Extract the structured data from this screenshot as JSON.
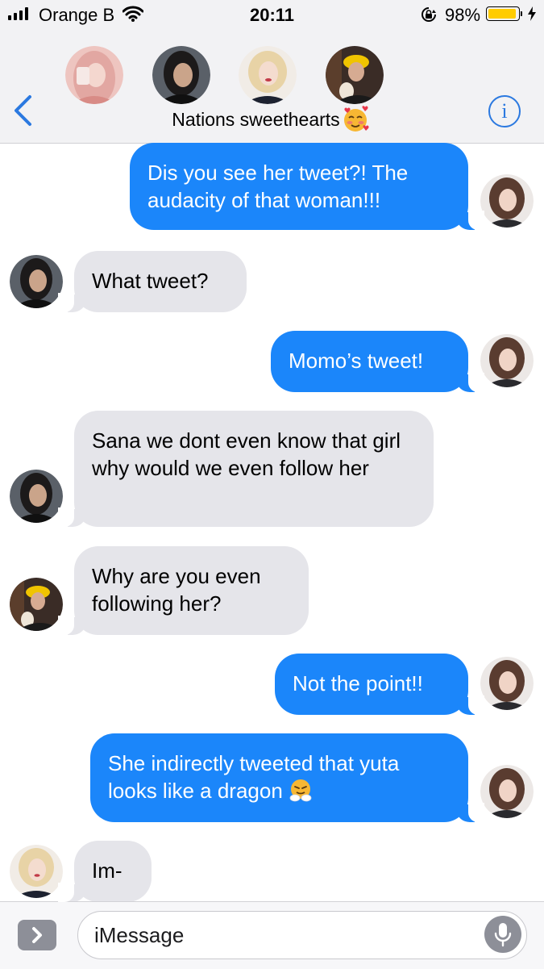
{
  "status_bar": {
    "carrier": "Orange B",
    "time": "20:11",
    "battery_percent": "98%",
    "battery_level": 0.98
  },
  "header": {
    "group_name": "Nations sweethearts",
    "group_emoji": "smiling-face-with-hearts",
    "participants": [
      "avatar-1",
      "avatar-2",
      "avatar-3",
      "avatar-4"
    ],
    "info_label": "i"
  },
  "messages": [
    {
      "side": "out",
      "text": "Dis you see her tweet?! The audacity of that woman!!!"
    },
    {
      "side": "in",
      "text": "What tweet?"
    },
    {
      "side": "out",
      "text": "Momo’s tweet!"
    },
    {
      "side": "in",
      "text": "Sana we dont even know that girl why would we even follow her"
    },
    {
      "side": "in",
      "text": "Why are you even following her?"
    },
    {
      "side": "out",
      "text": "Not the point!!"
    },
    {
      "side": "out",
      "text": "She indirectly tweeted that yuta looks like a dragon",
      "emoji": "face-with-steam-from-nose"
    },
    {
      "side": "in",
      "text": "Im-"
    }
  ],
  "input": {
    "placeholder": "iMessage"
  },
  "colors": {
    "accent": "#2b79e0",
    "outgoing_bubble": "#1b86fa",
    "incoming_bubble": "#e5e5ea",
    "battery": "#ffcc00"
  }
}
